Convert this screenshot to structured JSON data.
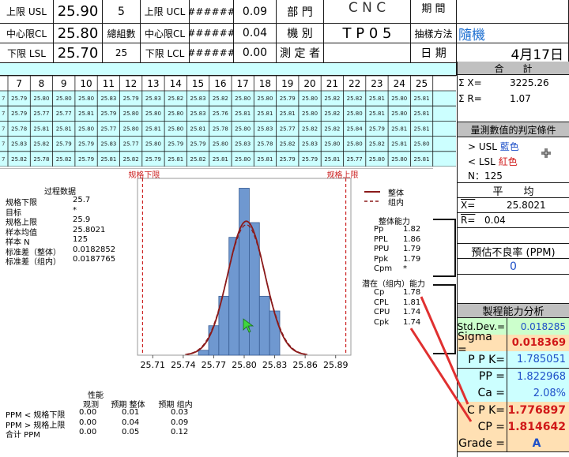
{
  "header": {
    "row1": {
      "usl_label": "上限 USL",
      "usl_value": "25.90",
      "count": "5",
      "ucl_label": "上限 UCL",
      "ucl_value": "######",
      "v1": "0.09",
      "dept_label": "部 門",
      "dept_value": "C N C",
      "period_label": "期 間"
    },
    "row2": {
      "cl_label": "中心限CL",
      "cl_value": "25.80",
      "groups_label": "總組數",
      "ucl2_label": "中心限CL",
      "ucl2_value": "######",
      "v2": "0.04",
      "machine_label": "機 別",
      "machine_value": "T P 0 5",
      "sample_label": "抽樣方法",
      "sample_value": "隨機"
    },
    "row3": {
      "lsl_label": "下限 LSL",
      "lsl_value": "25.70",
      "groups_count": "25",
      "lcl_label": "下限 LCL",
      "lcl_value": "######",
      "v3": "0.00",
      "tester_label": "測 定 者",
      "date_label": "日 期",
      "date_value": "4月17日"
    }
  },
  "grid": {
    "columns": [
      "7",
      "8",
      "9",
      "10",
      "11",
      "12",
      "13",
      "14",
      "15",
      "16",
      "17",
      "18",
      "19",
      "20",
      "21",
      "22",
      "23",
      "24",
      "25"
    ],
    "rows": [
      [
        "25.79",
        "25.80",
        "25.80",
        "25.80",
        "25.83",
        "25.79",
        "25.83",
        "25.82",
        "25.83",
        "25.82",
        "25.80",
        "25.80",
        "25.79",
        "25.80",
        "25.82",
        "25.82",
        "25.81",
        "25.80",
        "25.81"
      ],
      [
        "25.79",
        "25.77",
        "25.77",
        "25.81",
        "25.79",
        "25.80",
        "25.80",
        "25.80",
        "25.83",
        "25.76",
        "25.81",
        "25.81",
        "25.81",
        "25.80",
        "25.82",
        "25.80",
        "25.81",
        "25.80",
        "25.81"
      ],
      [
        "25.78",
        "25.81",
        "25.81",
        "25.80",
        "25.77",
        "25.80",
        "25.81",
        "25.80",
        "25.81",
        "25.78",
        "25.80",
        "25.83",
        "25.77",
        "25.82",
        "25.82",
        "25.84",
        "25.79",
        "25.81",
        "25.81"
      ],
      [
        "25.83",
        "25.82",
        "25.79",
        "25.79",
        "25.83",
        "25.77",
        "25.80",
        "25.79",
        "25.79",
        "25.80",
        "25.83",
        "25.78",
        "25.82",
        "25.83",
        "25.80",
        "25.80",
        "25.82",
        "25.81",
        "25.80"
      ],
      [
        "25.82",
        "25.78",
        "25.82",
        "25.79",
        "25.81",
        "25.82",
        "25.79",
        "25.81",
        "25.82",
        "25.81",
        "25.80",
        "25.81",
        "25.79",
        "25.79",
        "25.81",
        "25.77",
        "25.80",
        "25.80",
        "25.81"
      ]
    ]
  },
  "right_panel": {
    "total_title": "合　　計",
    "sum_x_label": "Σ X=",
    "sum_x_value": "3225.26",
    "sum_r_label": "Σ R=",
    "sum_r_value": "1.07",
    "judge_title": "量測數值的判定條件",
    "usl_line": "> USL",
    "usl_color_name": "藍色",
    "lsl_line": "< LSL",
    "lsl_color_name": "紅色",
    "n_label": "N：125",
    "avg_title": "平　　均",
    "xbarbar_label": "X=",
    "xbarbar_value": "25.8021",
    "rbar_label": "R=",
    "rbar_value": "0.04",
    "ppm_title": "預估不良率 (PPM)",
    "ppm_value": "0",
    "cap_title": "製程能力分析",
    "cap_rows": [
      {
        "label": "Std.Dev.=",
        "value": "0.018285"
      },
      {
        "label": "Sigma =",
        "value": "0.018369"
      },
      {
        "label": "P P K=",
        "value": "1.785051"
      },
      {
        "label": "PP =",
        "value": "1.822968"
      },
      {
        "label": "Ca =",
        "value": "2.08%"
      },
      {
        "label": "C P K=",
        "value": "1.776897"
      },
      {
        "label": "CP =",
        "value": "1.814642"
      },
      {
        "label": "Grade =",
        "value": "A"
      }
    ]
  },
  "minitab": {
    "lsl_tag": "规格下限",
    "usl_tag": "规格上限",
    "process_title": "过程数据",
    "process": [
      {
        "label": "规格下限",
        "value": "25.7"
      },
      {
        "label": "目标",
        "value": "*"
      },
      {
        "label": "规格上限",
        "value": "25.9"
      },
      {
        "label": "样本均值",
        "value": "25.8021"
      },
      {
        "label": "样本 N",
        "value": "125"
      },
      {
        "label": "标准差（整体）",
        "value": "0.0182852"
      },
      {
        "label": "标准差（组内）",
        "value": "0.0187765"
      }
    ],
    "legend_overall": "整体",
    "legend_within": "组内",
    "overall_title": "整体能力",
    "overall": [
      {
        "label": "Pp",
        "value": "1.82"
      },
      {
        "label": "PPL",
        "value": "1.86"
      },
      {
        "label": "PPU",
        "value": "1.79"
      },
      {
        "label": "Ppk",
        "value": "1.79"
      },
      {
        "label": "Cpm",
        "value": "*"
      }
    ],
    "potential_title": "潜在（组内）能力",
    "potential": [
      {
        "label": "Cp",
        "value": "1.78"
      },
      {
        "label": "CPL",
        "value": "1.81"
      },
      {
        "label": "CPU",
        "value": "1.74"
      },
      {
        "label": "Cpk",
        "value": "1.74"
      }
    ],
    "perf_title": "性能",
    "perf_cols": [
      "观测",
      "预期 整体",
      "预期 组内"
    ],
    "perf_rows": [
      {
        "label": "PPM < 规格下限",
        "v": [
          "0.00",
          "0.01",
          "0.03"
        ]
      },
      {
        "label": "PPM > 规格上限",
        "v": [
          "0.00",
          "0.04",
          "0.09"
        ]
      },
      {
        "label": "合计 PPM",
        "v": [
          "0.00",
          "0.05",
          "0.12"
        ]
      }
    ]
  },
  "chart_data": {
    "type": "bar",
    "title": "",
    "x_ticks": [
      "25.71",
      "25.74",
      "25.77",
      "25.80",
      "25.83",
      "25.86",
      "25.89"
    ],
    "xlim": [
      25.695,
      25.905
    ],
    "spec_lower": 25.7,
    "spec_upper": 25.9,
    "bin_width": 0.01,
    "bins": [
      {
        "x": 25.76,
        "count": 1
      },
      {
        "x": 25.77,
        "count": 6
      },
      {
        "x": 25.78,
        "count": 12
      },
      {
        "x": 25.79,
        "count": 24
      },
      {
        "x": 25.8,
        "count": 34
      },
      {
        "x": 25.81,
        "count": 27
      },
      {
        "x": 25.82,
        "count": 12
      },
      {
        "x": 25.83,
        "count": 9
      }
    ],
    "ymax": 36,
    "series": [
      {
        "name": "整体",
        "mean": 25.8021,
        "sd": 0.0182852,
        "style": "solid"
      },
      {
        "name": "组内",
        "mean": 25.8021,
        "sd": 0.0187765,
        "style": "dashed"
      }
    ],
    "colors": {
      "bar": "#6f98d0",
      "bar_edge": "#3a5e95",
      "curve": "#8b1a1a",
      "spec": "#cc2222"
    }
  }
}
